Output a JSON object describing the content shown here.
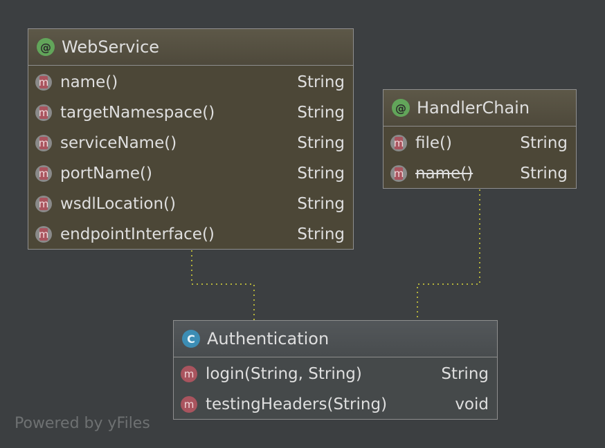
{
  "nodes": {
    "webservice": {
      "kind": "@",
      "title": "WebService",
      "members": [
        {
          "icon": "m",
          "name": "name()",
          "type": "String"
        },
        {
          "icon": "m",
          "name": "targetNamespace()",
          "type": "String"
        },
        {
          "icon": "m",
          "name": "serviceName()",
          "type": "String"
        },
        {
          "icon": "m",
          "name": "portName()",
          "type": "String"
        },
        {
          "icon": "m",
          "name": "wsdlLocation()",
          "type": "String"
        },
        {
          "icon": "m",
          "name": "endpointInterface()",
          "type": "String"
        }
      ]
    },
    "handlerchain": {
      "kind": "@",
      "title": "HandlerChain",
      "members": [
        {
          "icon": "m",
          "name": "file()",
          "type": "String"
        },
        {
          "icon": "m",
          "name": "name()",
          "type": "String"
        }
      ]
    },
    "authentication": {
      "kind": "C",
      "title": "Authentication",
      "members": [
        {
          "icon": "m",
          "name": "login(String, String)",
          "type": "String"
        },
        {
          "icon": "m",
          "name": "testingHeaders(String)",
          "type": "void"
        }
      ]
    }
  },
  "colors": {
    "annotation": "#62a55a",
    "class": "#3c8db4",
    "method": "#a9545e",
    "edge": "#b5b33b"
  },
  "footer": "Powered by yFiles"
}
